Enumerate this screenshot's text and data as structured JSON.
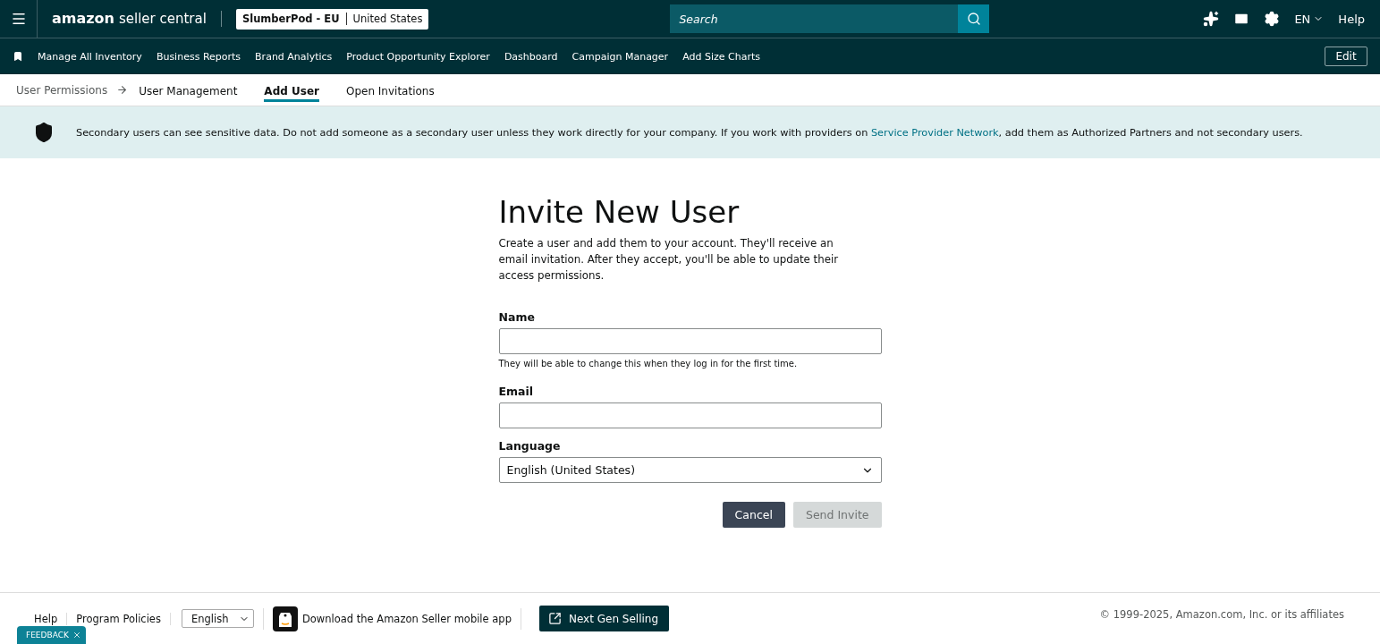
{
  "top_bar": {
    "logo_brand": "amazon",
    "logo_product": "seller central",
    "account": {
      "store": "SlumberPod - EU",
      "region": "United States"
    },
    "search": {
      "placeholder": "Search"
    },
    "language": "EN",
    "help": "Help"
  },
  "nav": {
    "items": [
      "Manage All Inventory",
      "Business Reports",
      "Brand Analytics",
      "Product Opportunity Explorer",
      "Dashboard",
      "Campaign Manager",
      "Add Size Charts"
    ],
    "edit": "Edit"
  },
  "breadcrumb": {
    "root": "User Permissions",
    "tabs": [
      {
        "label": "User Management",
        "selected": false
      },
      {
        "label": "Add User",
        "selected": true
      },
      {
        "label": "Open Invitations",
        "selected": false
      }
    ]
  },
  "banner": {
    "before": "Secondary users can see sensitive data. Do not add someone as a secondary user unless they work directly for your company. If you work with providers on ",
    "link": "Service Provider Network",
    "after": ", add them as Authorized Partners and not secondary users."
  },
  "form": {
    "title": "Invite New User",
    "intro": "Create a user and add them to your account. They'll receive an email invitation. After they accept, you'll be able to update their access permissions.",
    "fields": [
      {
        "kind": "text",
        "label": "Name",
        "hint": "They will be able to change this when they log in for the first time."
      },
      {
        "kind": "text",
        "label": "Email"
      },
      {
        "kind": "select",
        "label": "Language",
        "value": "English (United States)"
      }
    ],
    "buttons": [
      {
        "label": "Cancel",
        "disabled": false
      },
      {
        "label": "Send Invite",
        "disabled": true
      }
    ]
  },
  "footer": {
    "links": [
      "Help",
      "Program Policies"
    ],
    "language": "English",
    "app": "Download the Amazon Seller mobile app",
    "next_gen": "Next Gen Selling",
    "copyright": "© 1999-2025, Amazon.com, Inc. or its affiliates",
    "feedback": "FEEDBACK"
  }
}
